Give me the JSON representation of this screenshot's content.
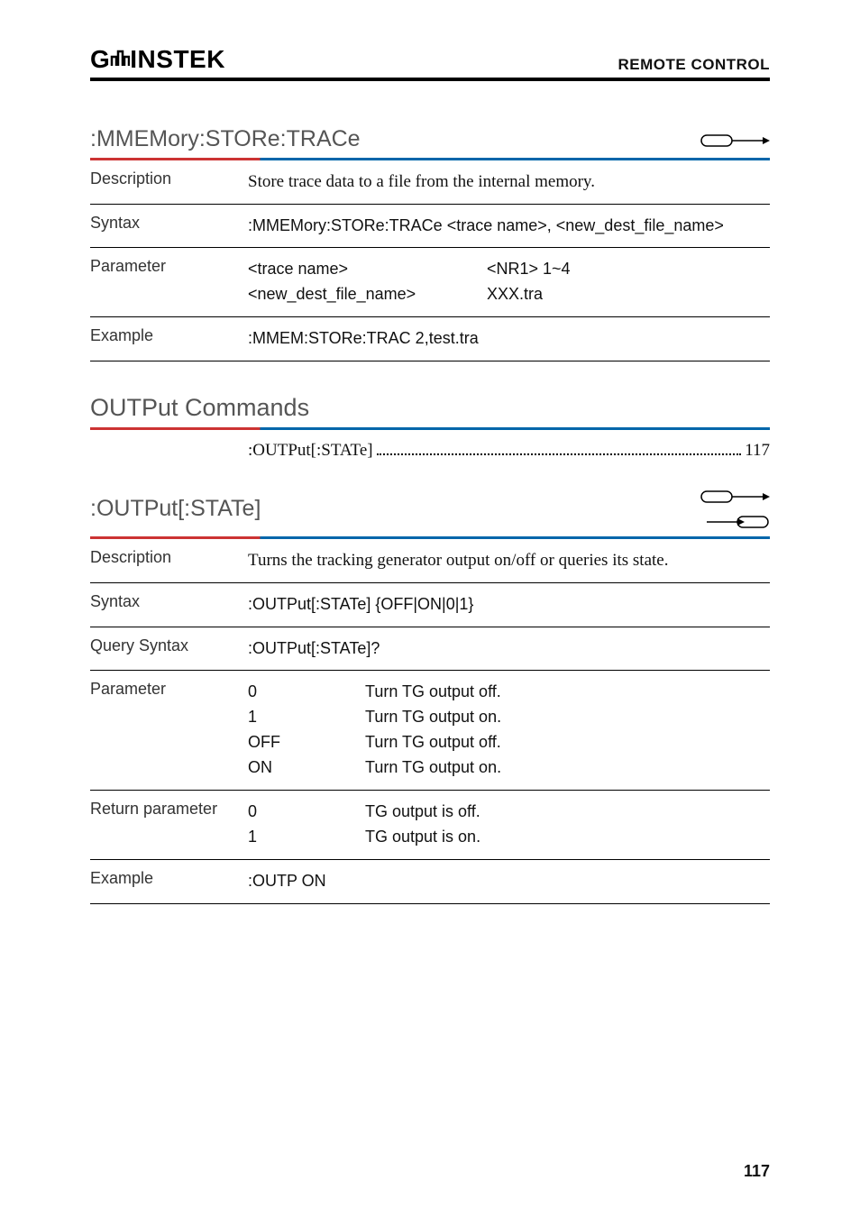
{
  "header": {
    "logo_text": "GWINSTEK",
    "right_text": "REMOTE CONTROL"
  },
  "cmd1": {
    "title": ":MMEMory:STORe:TRACe",
    "desc_label": "Description",
    "desc_text": "Store trace data to a file from the internal memory.",
    "syntax_label": "Syntax",
    "syntax_text": ":MMEMory:STORe:TRACe <trace name>, <new_dest_file_name>",
    "param_label": "Parameter",
    "param_r1c1": "<trace name>",
    "param_r1c2": "<NR1> 1~4",
    "param_r2c1": "<new_dest_file_name>",
    "param_r2c2": "XXX.tra",
    "example_label": "Example",
    "example_text": ":MMEM:STORe:TRAC 2,test.tra"
  },
  "section2_title": "OUTPut Commands",
  "toc": {
    "item": ":OUTPut[:STATe]",
    "page": "117"
  },
  "cmd2": {
    "title": ":OUTPut[:STATe]",
    "desc_label": "Description",
    "desc_text": "Turns the tracking generator output on/off or queries its state.",
    "syntax_label": "Syntax",
    "syntax_text": ":OUTPut[:STATe] {OFF|ON|0|1}",
    "qsyntax_label": "Query Syntax",
    "qsyntax_text": ":OUTPut[:STATe]?",
    "param_label": "Parameter",
    "p1v": "0",
    "p1t": "Turn TG output off.",
    "p2v": "1",
    "p2t": "Turn TG output on.",
    "p3v": "OFF",
    "p3t": "Turn TG output off.",
    "p4v": "ON",
    "p4t": "Turn TG output on.",
    "ret_label": "Return parameter",
    "r1v": "0",
    "r1t": "TG output is off.",
    "r2v": "1",
    "r2t": "TG output is on.",
    "example_label": "Example",
    "example_text": ":OUTP ON"
  },
  "page_number": "117"
}
